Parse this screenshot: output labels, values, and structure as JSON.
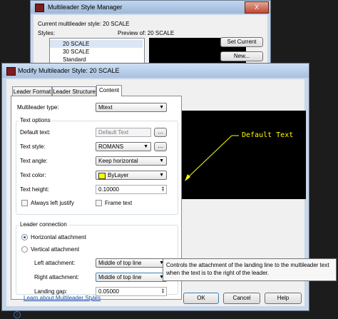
{
  "manager": {
    "title": "Multileader Style Manager",
    "close_label": "X",
    "current_style": "Current multileader style: 20 SCALE",
    "styles_label": "Styles:",
    "styles": [
      "20 SCALE",
      "30 SCALE",
      "Standard"
    ],
    "preview_label": "Preview of: 20 SCALE",
    "set_current_label": "Set Current",
    "new_label": "New..."
  },
  "dialog": {
    "title": "Modify Multileader Style: 20 SCALE",
    "tabs": [
      {
        "label": "Leader Format",
        "active": false
      },
      {
        "label": "Leader Structure",
        "active": false
      },
      {
        "label": "Content",
        "active": true
      }
    ],
    "multileader_type_label": "Multileader type:",
    "multileader_type_value": "Mtext",
    "text_options_title": "Text options",
    "default_text_label": "Default text:",
    "default_text_value": "Default Text",
    "browse_label": "...",
    "text_style_label": "Text style:",
    "text_style_value": "ROMANS",
    "text_angle_label": "Text angle:",
    "text_angle_value": "Keep horizontal",
    "text_color_label": "Text color:",
    "text_color_value": "ByLayer",
    "text_color_swatch": "#ffff00",
    "text_height_label": "Text height:",
    "text_height_value": "0.10000",
    "always_left_justify_label": "Always left justify",
    "frame_text_label": "Frame text",
    "leader_connection_title": "Leader connection",
    "horizontal_attachment_label": "Horizontal attachment",
    "vertical_attachment_label": "Vertical attachment",
    "left_attachment_label": "Left attachment:",
    "left_attachment_value": "Middle of top line",
    "right_attachment_label": "Right attachment:",
    "right_attachment_value": "Middle of top line",
    "landing_gap_label": "Landing gap:",
    "landing_gap_value": "0.05000",
    "preview_text": "Default Text",
    "preview_color": "#ffff00",
    "learn_link": "Learn about Multileader Styles",
    "ok_label": "OK",
    "cancel_label": "Cancel",
    "help_label": "Help"
  },
  "tooltip": "Controls the attachment of the landing line to the multileader text when the text is to the right of the leader."
}
